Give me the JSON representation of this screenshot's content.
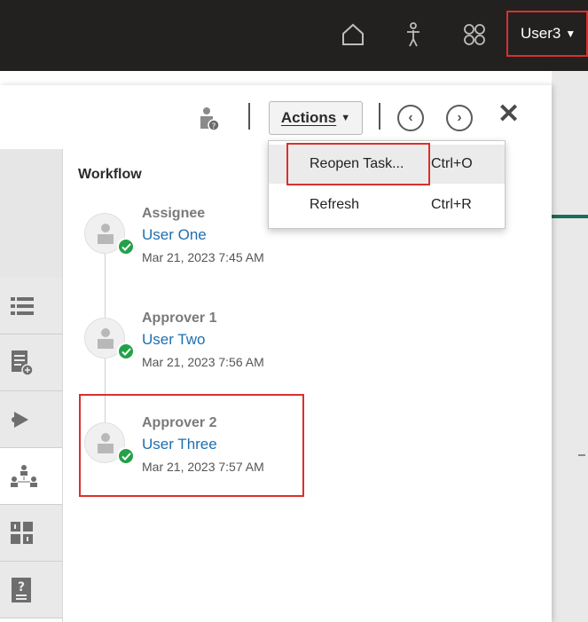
{
  "header": {
    "user_label": "User3",
    "icons": [
      "home-icon",
      "navigator-icon",
      "apps-grid-icon"
    ]
  },
  "toolbar": {
    "actions_label": "Actions",
    "icons": [
      "user-help-icon",
      "previous-icon",
      "next-icon",
      "close-icon"
    ]
  },
  "actions_menu": {
    "items": [
      {
        "label": "Reopen Task...",
        "shortcut": "Ctrl+O"
      },
      {
        "label": "Refresh",
        "shortcut": "Ctrl+R"
      }
    ]
  },
  "sidebar": {
    "tabs": [
      "list-icon",
      "document-icon",
      "bell-icon",
      "workflow-icon",
      "attributes-icon",
      "help-doc-icon"
    ],
    "active_tab": "workflow-icon"
  },
  "workflow": {
    "title": "Workflow",
    "steps": [
      {
        "role": "Assignee",
        "user": "User One",
        "date": "Mar 21, 2023 7:45 AM"
      },
      {
        "role": "Approver 1",
        "user": "User Two",
        "date": "Mar 21, 2023 7:56 AM"
      },
      {
        "role": "Approver 2",
        "user": "User Three",
        "date": "Mar 21, 2023 7:57 AM"
      }
    ]
  },
  "colors": {
    "topbar": "#232120",
    "link": "#1d6fb1",
    "success": "#24a148",
    "highlight": "#d9302c"
  }
}
